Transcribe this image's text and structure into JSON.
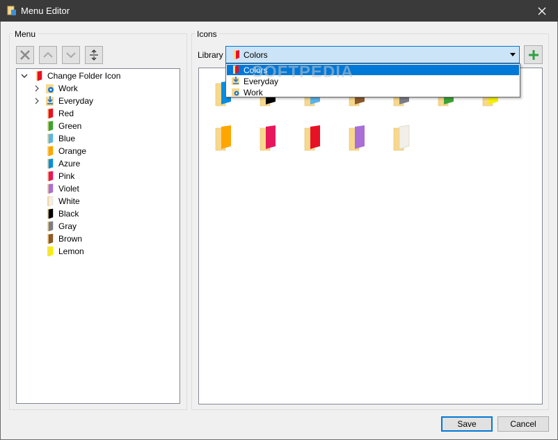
{
  "window": {
    "title": "Menu Editor"
  },
  "menu_group": {
    "label": "Menu"
  },
  "icons_group": {
    "label": "Icons"
  },
  "tree": {
    "root": {
      "label": "Change Folder Icon",
      "color": "#e81123"
    },
    "items": [
      {
        "label": "Work",
        "type": "work",
        "expandable": true
      },
      {
        "label": "Everyday",
        "type": "everyday",
        "expandable": true
      },
      {
        "label": "Red",
        "color": "#e81123"
      },
      {
        "label": "Green",
        "color": "#3aa335"
      },
      {
        "label": "Blue",
        "color": "#5ab4e8"
      },
      {
        "label": "Orange",
        "color": "#ffa500"
      },
      {
        "label": "Azure",
        "color": "#0a8de0"
      },
      {
        "label": "Pink",
        "color": "#e8175d"
      },
      {
        "label": "Violet",
        "color": "#a86fd6"
      },
      {
        "label": "White",
        "color": "#f2efe8"
      },
      {
        "label": "Black",
        "color": "#000000"
      },
      {
        "label": "Gray",
        "color": "#7d7d86"
      },
      {
        "label": "Brown",
        "color": "#8b5a2b"
      },
      {
        "label": "Lemon",
        "color": "#f5ef00"
      }
    ]
  },
  "library": {
    "label": "Library",
    "selected": "Colors",
    "options": [
      "Colors",
      "Everyday",
      "Work"
    ]
  },
  "icon_grid": {
    "row1": [
      "#0a8de0",
      "#000000",
      "#5ab4e8",
      "#8b5a2b",
      "#7d7d86",
      "#3aa335",
      "#f5ef00"
    ],
    "row2": [
      "#ffa500",
      "#e8175d",
      "#e81123",
      "#a86fd6",
      "#f2efe8"
    ]
  },
  "watermark": {
    "text": "SOFTPEDIA"
  },
  "buttons": {
    "save": "Save",
    "cancel": "Cancel"
  },
  "colors": {
    "accent": "#0078d7",
    "folder": "#f7d88c"
  }
}
